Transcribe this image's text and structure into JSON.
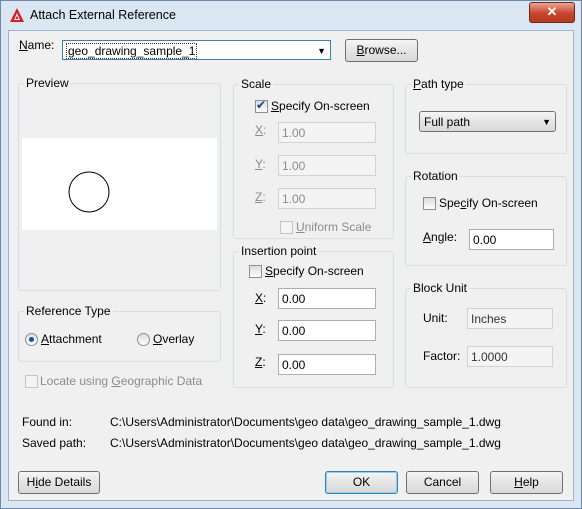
{
  "window": {
    "title": "Attach External Reference",
    "close_glyph": "✕"
  },
  "name": {
    "label_pre": "",
    "label_ul": "N",
    "label_post": "ame:",
    "value": "geo_drawing_sample_1",
    "browse_ul": "B",
    "browse_post": "rowse..."
  },
  "preview": {
    "title": "Preview"
  },
  "scale": {
    "title": "Scale",
    "specify": {
      "pre": "",
      "ul": "S",
      "post": "pecify On-screen",
      "checked": "✔"
    },
    "x": {
      "ul": "X",
      "post": ":",
      "value": "1.00"
    },
    "y": {
      "ul": "Y",
      "post": ":",
      "value": "1.00"
    },
    "z": {
      "ul": "Z",
      "post": ":",
      "value": "1.00"
    },
    "uniform": {
      "ul": "U",
      "post": "niform Scale"
    }
  },
  "insertion": {
    "title": "Insertion point",
    "specify": {
      "ul": "S",
      "post": "pecify On-screen"
    },
    "x": {
      "ul": "X",
      "post": ":",
      "value": "0.00"
    },
    "y": {
      "ul": "Y",
      "post": ":",
      "value": "0.00"
    },
    "z": {
      "ul": "Z",
      "post": ":",
      "value": "0.00"
    }
  },
  "path_type": {
    "title_ul": "P",
    "title_post": "ath type",
    "value": "Full path"
  },
  "rotation": {
    "title": "Rotation",
    "specify": {
      "pre": "Spe",
      "ul": "c",
      "post": "ify On-screen"
    },
    "angle_pre": "",
    "angle_ul": "A",
    "angle_post": "ngle:",
    "angle_value": "0.00"
  },
  "block_unit": {
    "title": "Block Unit",
    "unit_label": "Unit:",
    "unit_value": "Inches",
    "factor_label": "Factor:",
    "factor_value": "1.0000"
  },
  "reference_type": {
    "title": "Reference Type",
    "attachment": {
      "ul": "A",
      "post": "ttachment"
    },
    "overlay": {
      "ul": "O",
      "post": "verlay"
    }
  },
  "geo": {
    "pre": "Locate using ",
    "ul": "G",
    "post": "eographic Data"
  },
  "found_in": {
    "label": "Found in:",
    "value": "C:\\Users\\Administrator\\Documents\\geo data\\geo_drawing_sample_1.dwg"
  },
  "saved_path": {
    "label": "Saved path:",
    "value": "C:\\Users\\Administrator\\Documents\\geo data\\geo_drawing_sample_1.dwg"
  },
  "buttons": {
    "hide_details": {
      "pre": "H",
      "ul": "i",
      "post": "de Details"
    },
    "ok": "OK",
    "cancel": "Cancel",
    "help": {
      "ul": "H",
      "post": "elp"
    }
  }
}
